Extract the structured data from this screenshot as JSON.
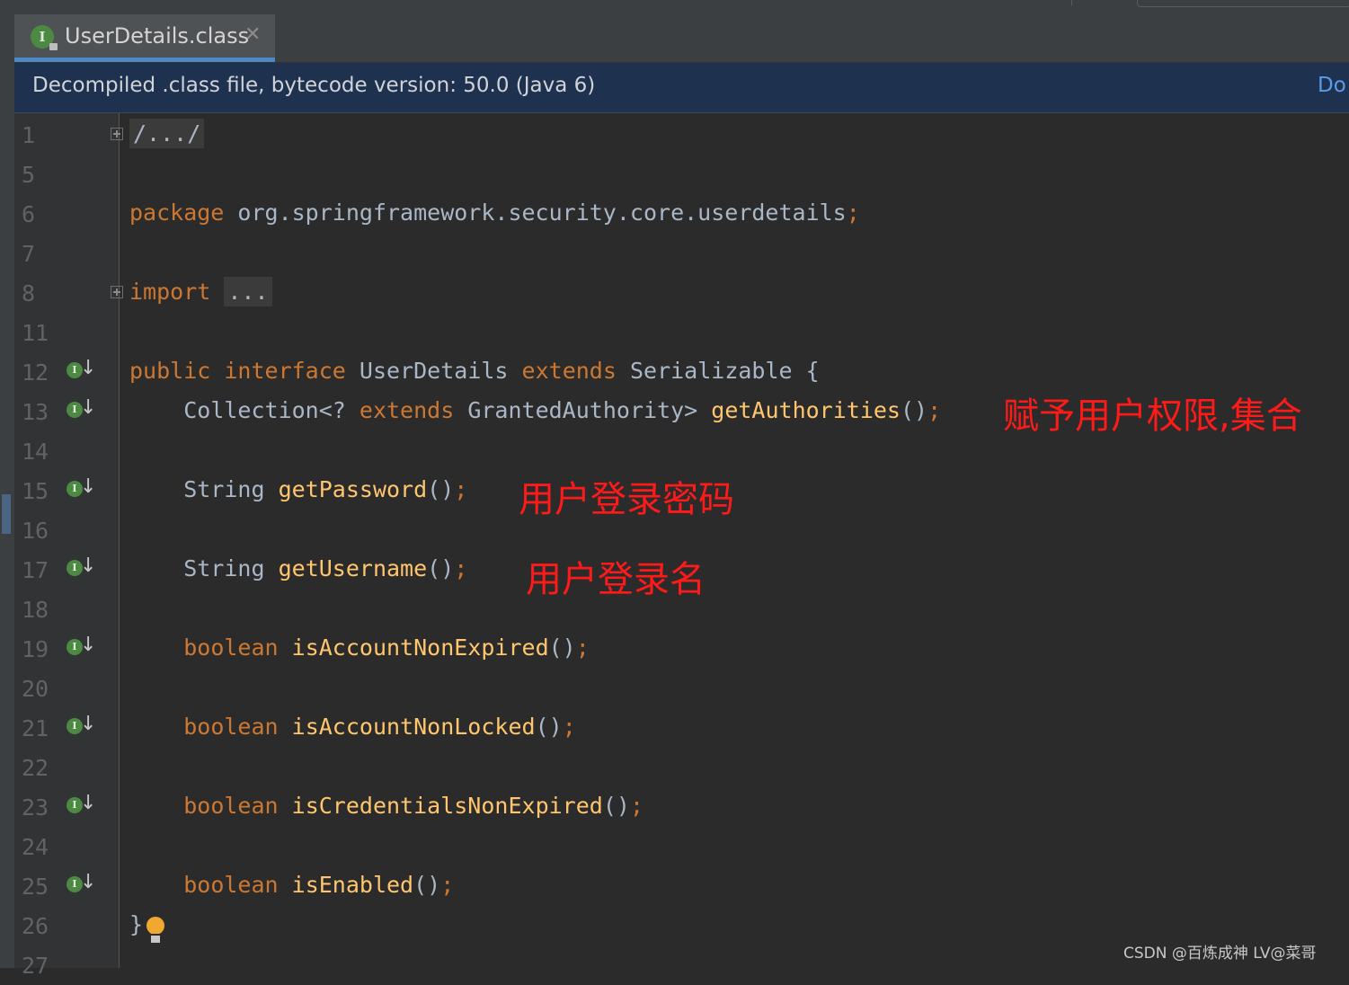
{
  "tab": {
    "title": "UserDetails.class",
    "icon_letter": "I",
    "close": "✕"
  },
  "banner": {
    "text": "Decompiled .class file, bytecode version: 50.0 (Java 6)",
    "link": "Do"
  },
  "gutter": {
    "line_numbers": [
      "1",
      "5",
      "6",
      "7",
      "8",
      "11",
      "12",
      "13",
      "14",
      "15",
      "16",
      "17",
      "18",
      "19",
      "20",
      "21",
      "22",
      "23",
      "24",
      "25",
      "26",
      "27"
    ],
    "implements_marker_letter": "I"
  },
  "code": {
    "l1_header": "/.../",
    "l6_package_kw": "package",
    "l6_package_name": "org.springframework.security.core.userdetails",
    "l6_semicolon": ";",
    "l8_import_kw": "import",
    "l8_import_folded": "...",
    "l12_public": "public",
    "l12_interface": "interface",
    "l12_name": "UserDetails",
    "l12_extends": "extends",
    "l12_super": "Serializable",
    "l12_brace": "{",
    "l13_type_a": "Collection<?",
    "l13_extends": "extends",
    "l13_type_b": "GrantedAuthority>",
    "l13_method": "getAuthorities",
    "l15_type": "String",
    "l15_method": "getPassword",
    "l17_type": "String",
    "l17_method": "getUsername",
    "l19_type": "boolean",
    "l19_method": "isAccountNonExpired",
    "l21_type": "boolean",
    "l21_method": "isAccountNonLocked",
    "l23_type": "boolean",
    "l23_method": "isCredentialsNonExpired",
    "l25_type": "boolean",
    "l25_method": "isEnabled",
    "parens": "()",
    "semicolon": ";",
    "l26_close": "}"
  },
  "annotations": {
    "authorities": "赋予用户权限,集合",
    "password": "用户登录密码",
    "username": "用户登录名"
  },
  "watermark": "CSDN @百炼成神 LV@菜哥",
  "colors": {
    "background": "#2b2b2b",
    "keyword": "#cc7832",
    "method": "#ffc66d",
    "text": "#a9b7c6",
    "annotation": "#ff1a1a",
    "banner_bg": "#1e3250",
    "tab_underline": "#4a88c7"
  }
}
